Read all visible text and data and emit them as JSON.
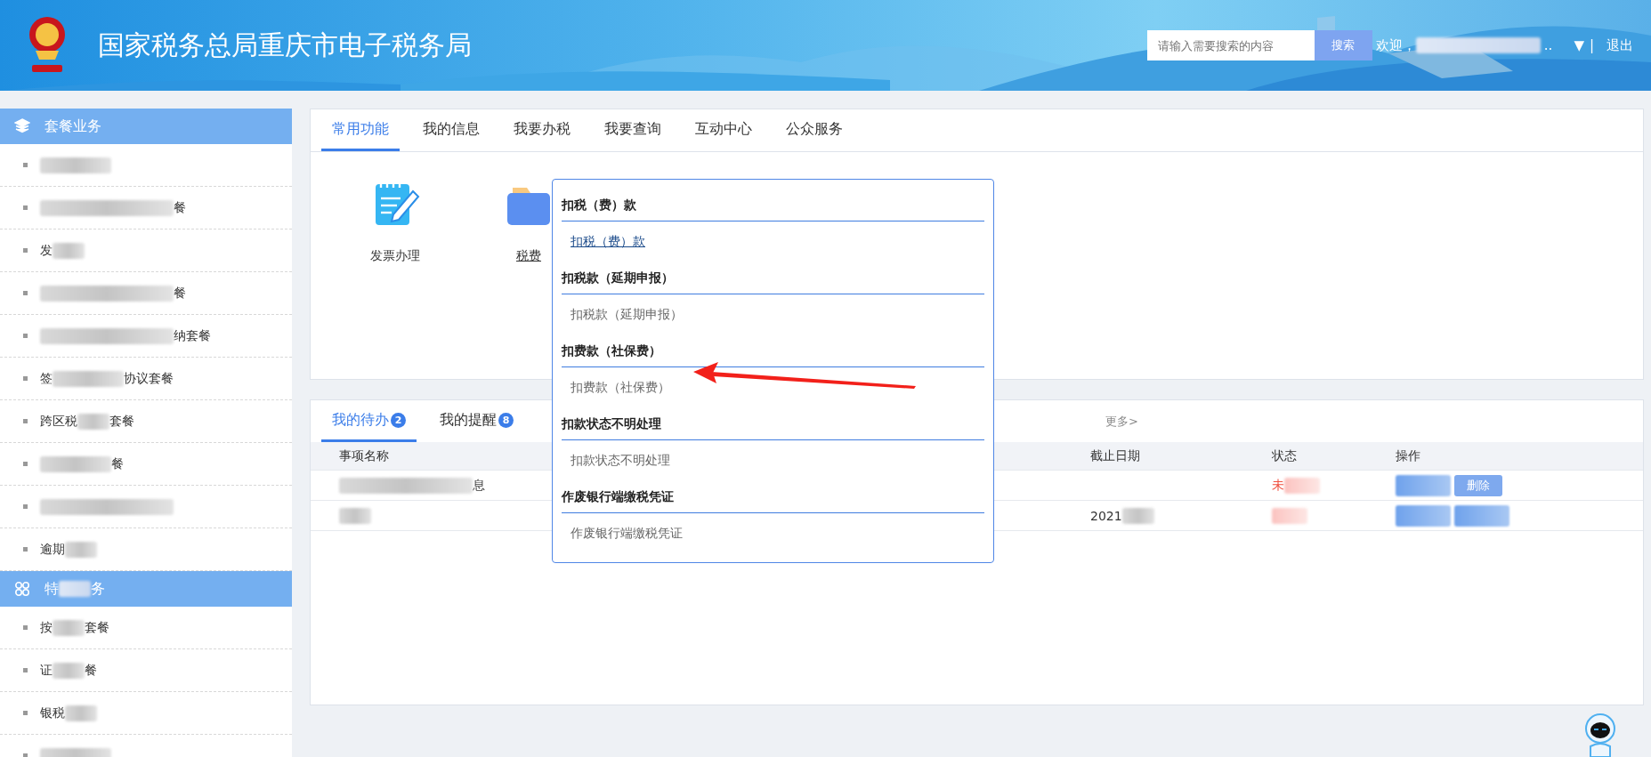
{
  "header": {
    "title": "国家税务总局重庆市电子税务局",
    "search": {
      "placeholder": "请输入需要搜索的内容",
      "button": "搜索"
    },
    "welcome": "欢迎，",
    "ellipsis": "..",
    "menu_caret": "▼",
    "separator": "|",
    "logout": "退出"
  },
  "sidebar": {
    "sections": [
      {
        "title": [
          {
            "kind": "text",
            "text": "套餐业务"
          }
        ],
        "items": [
          {
            "parts": [
              {
                "kind": "blur-mid"
              }
            ]
          },
          {
            "parts": [
              {
                "kind": "blur-long"
              },
              {
                "kind": "text",
                "text": "餐"
              }
            ]
          },
          {
            "parts": [
              {
                "kind": "text",
                "text": "发"
              },
              {
                "kind": "blur-short"
              }
            ]
          },
          {
            "parts": [
              {
                "kind": "blur-long"
              },
              {
                "kind": "text",
                "text": "餐"
              }
            ]
          },
          {
            "parts": [
              {
                "kind": "blur-long"
              },
              {
                "kind": "text",
                "text": "纳套餐"
              }
            ]
          },
          {
            "parts": [
              {
                "kind": "text",
                "text": "签"
              },
              {
                "kind": "blur-mid"
              },
              {
                "kind": "text",
                "text": "协议套餐"
              }
            ]
          },
          {
            "parts": [
              {
                "kind": "text",
                "text": "跨区税"
              },
              {
                "kind": "blur-short"
              },
              {
                "kind": "text",
                "text": "套餐"
              }
            ]
          },
          {
            "parts": [
              {
                "kind": "blur-mid"
              },
              {
                "kind": "text",
                "text": "餐"
              }
            ]
          },
          {
            "parts": [
              {
                "kind": "blur-long"
              }
            ]
          },
          {
            "parts": [
              {
                "kind": "text",
                "text": "逾期"
              },
              {
                "kind": "blur-short"
              }
            ]
          }
        ]
      },
      {
        "title": [
          {
            "kind": "text",
            "text": "特"
          },
          {
            "kind": "blur-short"
          },
          {
            "kind": "text",
            "text": "务"
          }
        ],
        "items": [
          {
            "parts": [
              {
                "kind": "text",
                "text": "按"
              },
              {
                "kind": "blur-short"
              },
              {
                "kind": "text",
                "text": "套餐"
              }
            ]
          },
          {
            "parts": [
              {
                "kind": "text",
                "text": "证"
              },
              {
                "kind": "blur-short"
              },
              {
                "kind": "text",
                "text": "餐"
              }
            ]
          },
          {
            "parts": [
              {
                "kind": "text",
                "text": "银税"
              },
              {
                "kind": "blur-short"
              }
            ]
          },
          {
            "parts": [
              {
                "kind": "blur-mid"
              }
            ]
          }
        ]
      }
    ]
  },
  "main_tabs": [
    {
      "label": "常用功能",
      "selected": true
    },
    {
      "label": "我的信息",
      "selected": false
    },
    {
      "label": "我要办税",
      "selected": false
    },
    {
      "label": "我要查询",
      "selected": false
    },
    {
      "label": "互动中心",
      "selected": false
    },
    {
      "label": "公众服务",
      "selected": false
    }
  ],
  "shortcuts": [
    {
      "label": "发票办理",
      "hovered": false
    },
    {
      "label": "税费",
      "hovered": true
    }
  ],
  "dropdown": [
    {
      "heading": "扣税（费）款",
      "item": "扣税（费）款",
      "hovered": true
    },
    {
      "heading": "扣税款（延期申报）",
      "item": "扣税款（延期申报）",
      "hovered": false
    },
    {
      "heading": "扣费款（社保费）",
      "item": "扣费款（社保费）",
      "hovered": false
    },
    {
      "heading": "扣款状态不明处理",
      "item": "扣款状态不明处理",
      "hovered": false
    },
    {
      "heading": "作废银行端缴税凭证",
      "item": "作废银行端缴税凭证",
      "hovered": false
    }
  ],
  "tasks": {
    "tabs": [
      {
        "label": "我的待办",
        "badge": "2",
        "selected": true
      },
      {
        "label": "我的提醒",
        "badge": "8",
        "selected": false
      }
    ],
    "more": "更多>",
    "columns": [
      "事项名称",
      "截止日期",
      "状态",
      "操作"
    ],
    "rows": [
      {
        "name": [
          {
            "kind": "blur-long"
          },
          {
            "kind": "text",
            "text": "息"
          }
        ],
        "deadline": [],
        "status": [
          {
            "kind": "text",
            "text": "未"
          },
          {
            "kind": "blur-red"
          }
        ],
        "actions": [
          {
            "kind": "blur"
          },
          {
            "kind": "button",
            "label": "删除"
          }
        ]
      },
      {
        "name": [
          {
            "kind": "blur-short"
          }
        ],
        "deadline": [
          {
            "kind": "text",
            "text": "2021"
          },
          {
            "kind": "blur-short"
          }
        ],
        "status": [
          {
            "kind": "blur-red"
          }
        ],
        "actions": [
          {
            "kind": "blur"
          },
          {
            "kind": "blur"
          }
        ]
      }
    ]
  }
}
